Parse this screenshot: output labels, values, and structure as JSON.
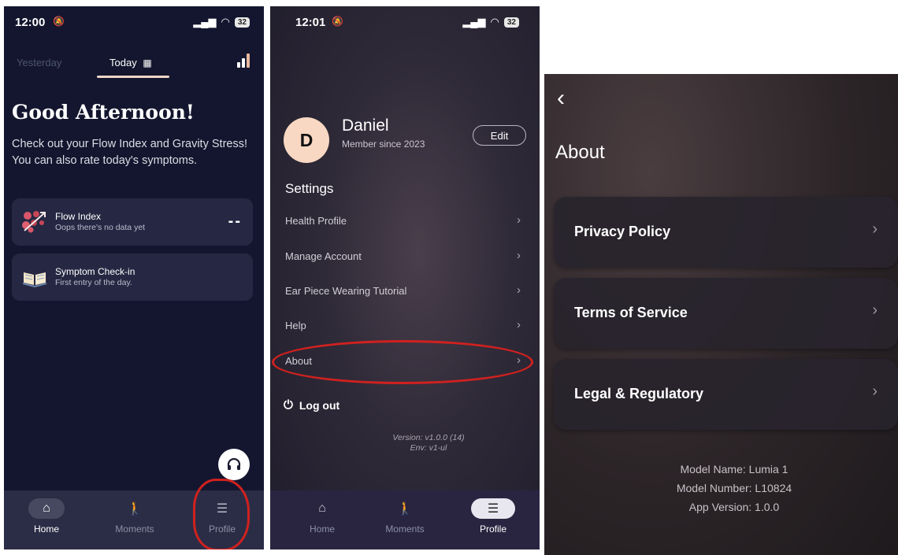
{
  "screen1": {
    "status": {
      "time": "12:00",
      "battery": "32"
    },
    "tabs": {
      "yesterday": "Yesterday",
      "today": "Today"
    },
    "greeting": "Good Afternoon!",
    "intro": "Check out your Flow Index and Gravity Stress! You can also rate today's symptoms.",
    "flow_card": {
      "title": "Flow Index",
      "subtitle": "Oops there's no data yet",
      "value": "--"
    },
    "symptom_card": {
      "title": "Symptom Check-in",
      "subtitle": "First entry of the day."
    },
    "nav": {
      "home": "Home",
      "moments": "Moments",
      "profile": "Profile"
    }
  },
  "screen2": {
    "status": {
      "time": "12:01",
      "battery": "32"
    },
    "profile": {
      "initial": "D",
      "name": "Daniel",
      "member_since": "Member since 2023",
      "edit_label": "Edit"
    },
    "settings_heading": "Settings",
    "settings_items": [
      "Health Profile",
      "Manage Account",
      "Ear Piece Wearing Tutorial",
      "Help",
      "About"
    ],
    "logout_label": "Log out",
    "version": "Version: v1.0.0 (14)",
    "env": "Env: v1-ul",
    "nav": {
      "home": "Home",
      "moments": "Moments",
      "profile": "Profile"
    }
  },
  "screen3": {
    "title": "About",
    "items": [
      "Privacy Policy",
      "Terms of Service",
      "Legal & Regulatory"
    ],
    "model_name": "Model Name: Lumia 1",
    "model_number": "Model Number: L10824",
    "app_version": "App Version: 1.0.0"
  },
  "colors": {
    "annotation": "#d0211f",
    "screen1_bg": "#13162e",
    "avatar_bg": "#f8d8c3"
  }
}
